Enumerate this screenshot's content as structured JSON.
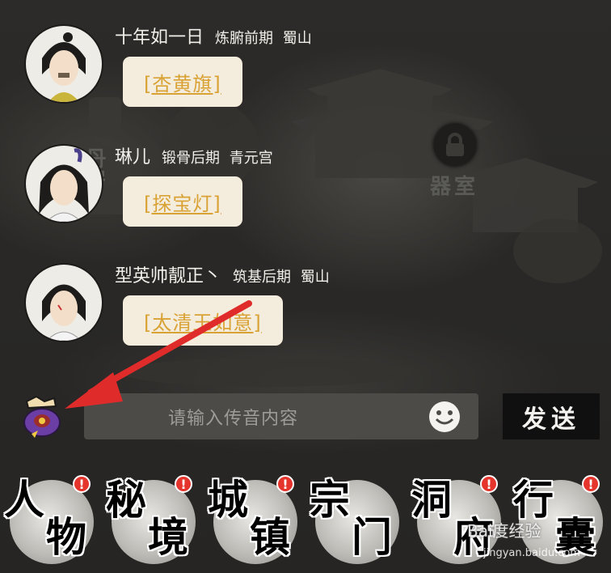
{
  "messages": [
    {
      "name": "十年如一日",
      "realm": "炼腑前期",
      "sect": "蜀山",
      "item": "[杏黄旗]"
    },
    {
      "name": "琳儿",
      "realm": "锻骨后期",
      "sect": "青元宫",
      "item": "[探宝灯]"
    },
    {
      "name": "型英帅靓正丶",
      "realm": "筑基后期",
      "sect": "蜀山",
      "item": "[太清玉如意]"
    }
  ],
  "map": {
    "building_label": "器室",
    "left_label": "丹房"
  },
  "input": {
    "placeholder": "请输入传音内容",
    "send_label": "发送"
  },
  "icons": {
    "bag": "pouch-icon",
    "emoji": "smiley-icon",
    "lock": "lock-icon"
  },
  "nav": [
    {
      "c1": "人",
      "c2": "物",
      "badge": "!"
    },
    {
      "c1": "秘",
      "c2": "境",
      "badge": "!"
    },
    {
      "c1": "城",
      "c2": "镇",
      "badge": "!"
    },
    {
      "c1": "宗",
      "c2": "门",
      "badge": ""
    },
    {
      "c1": "洞",
      "c2": "府",
      "badge": "!"
    },
    {
      "c1": "行",
      "c2": "囊",
      "badge": "!"
    }
  ],
  "watermark": {
    "brand": "Bai度经验",
    "url": "jingyan.baidu.com"
  },
  "colors": {
    "item": "#d9a235",
    "bubble": "#f4ecdc",
    "badge": "#e5342b",
    "arrow": "#e02b2b"
  }
}
